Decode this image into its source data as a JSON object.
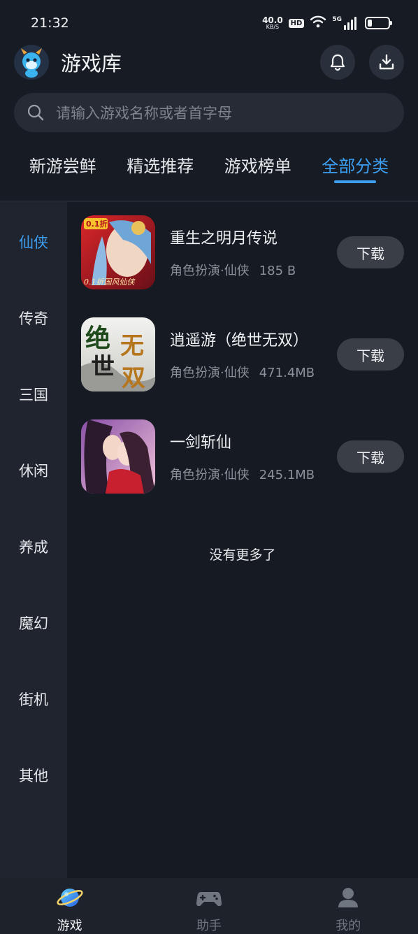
{
  "status_bar": {
    "time": "21:32",
    "net_speed": "40.0",
    "net_unit": "KB/S",
    "hd": "HD",
    "signal": "5G",
    "battery_level": 0.2
  },
  "header": {
    "title": "游戏库",
    "bell_icon": "bell-icon",
    "download_icon": "download-icon"
  },
  "search": {
    "placeholder": "请输入游戏名称或者首字母"
  },
  "tabs": [
    {
      "label": "新游尝鲜",
      "active": false
    },
    {
      "label": "精选推荐",
      "active": false
    },
    {
      "label": "游戏榜单",
      "active": false
    },
    {
      "label": "全部分类",
      "active": true
    }
  ],
  "sidebar": {
    "items": [
      {
        "label": "仙侠",
        "active": true
      },
      {
        "label": "传奇",
        "active": false
      },
      {
        "label": "三国",
        "active": false
      },
      {
        "label": "休闲",
        "active": false
      },
      {
        "label": "养成",
        "active": false
      },
      {
        "label": "魔幻",
        "active": false
      },
      {
        "label": "街机",
        "active": false
      },
      {
        "label": "其他",
        "active": false
      }
    ]
  },
  "games": [
    {
      "name": "重生之明月传说",
      "category": "角色扮演·仙侠",
      "size": "185 B",
      "button": "下载",
      "thumb_badge": "0.1折",
      "thumb_caption": "0.1折国风仙侠"
    },
    {
      "name": "逍遥游（绝世无双）",
      "category": "角色扮演·仙侠",
      "size": "471.4MB",
      "button": "下载",
      "thumb_text_1": "绝",
      "thumb_text_2": "无",
      "thumb_text_3": "世",
      "thumb_text_4": "双"
    },
    {
      "name": "一剑斩仙",
      "category": "角色扮演·仙侠",
      "size": "245.1MB",
      "button": "下载"
    }
  ],
  "no_more": "没有更多了",
  "bottom_nav": [
    {
      "label": "游戏",
      "icon": "planet-icon",
      "active": true
    },
    {
      "label": "助手",
      "icon": "gamepad-icon",
      "active": false
    },
    {
      "label": "我的",
      "icon": "user-icon",
      "active": false
    }
  ],
  "colors": {
    "accent": "#3d9ff2",
    "background": "#171b24",
    "sidebar": "#1f242e",
    "button": "#3a3e46"
  }
}
